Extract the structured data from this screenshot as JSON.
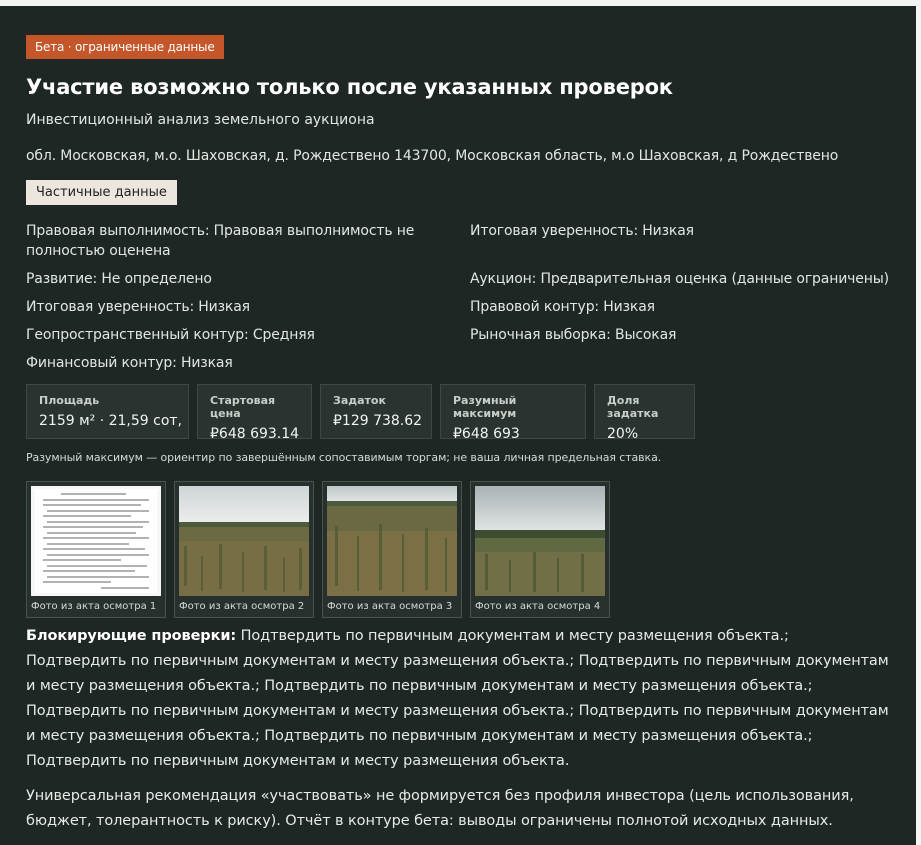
{
  "badge": "Бета · ограниченные данные",
  "title": "Участие возможно только после указанных проверок",
  "subtitle": "Инвестиционный анализ земельного аукциона",
  "address": "обл. Московская, м.о. Шаховская, д. Рождествено 143700, Московская область, м.о Шаховская, д Рождествено",
  "partial_button": "Частичные данные",
  "facts": [
    "Правовая выполнимость: Правовая выполнимость не полностью оценена",
    "Итоговая уверенность: Низкая",
    "Развитие: Не определено",
    "Аукцион: Предварительная оценка (данные ограничены)",
    "Итоговая уверенность: Низкая",
    "Правовой контур: Низкая",
    "Геопространственный контур: Средняя",
    "Рыночная выборка: Высокая",
    "Финансовый контур: Низкая"
  ],
  "metrics": [
    {
      "label": "Площадь",
      "value": "2159 м² · 21,59 сот,"
    },
    {
      "label": "Стартовая цена",
      "value": "₽648 693.14"
    },
    {
      "label": "Задаток",
      "value": "₽129 738.62"
    },
    {
      "label": "Разумный максимум",
      "value": "₽648 693"
    },
    {
      "label": "Доля задатка",
      "value": "20%"
    }
  ],
  "note": "Разумный максимум — ориентир по завершённым сопоставимым торгам; не ваша личная предельная ставка.",
  "photos": [
    {
      "caption": "Фото из акта осмотра 1"
    },
    {
      "caption": "Фото из акта осмотра 2"
    },
    {
      "caption": "Фото из акта осмотра 3"
    },
    {
      "caption": "Фото из акта осмотра 4"
    }
  ],
  "blocking_label": "Блокирующие проверки:",
  "blocking_text": "Подтвердить по первичным документам и месту размещения объекта.; Подтвердить по первичным документам и месту размещения объекта.; Подтвердить по первичным документам и месту размещения объекта.; Подтвердить по первичным документам и месту размещения объекта.; Подтвердить по первичным документам и месту размещения объекта.; Подтвердить по первичным документам и месту размещения объекта.; Подтвердить по первичным документам и месту размещения объекта.; Подтвердить по первичным документам и месту размещения объекта.",
  "recommendation": "Универсальная рекомендация «участвовать» не формируется без профиля инвестора (цель использования, бюджет, толерантность к риску). Отчёт в контуре бета: выводы ограничены полнотой исходных данных.",
  "colors": {
    "badge": "#c4562a",
    "panel": "#1e2723",
    "metric_bg": "#2a332f"
  }
}
